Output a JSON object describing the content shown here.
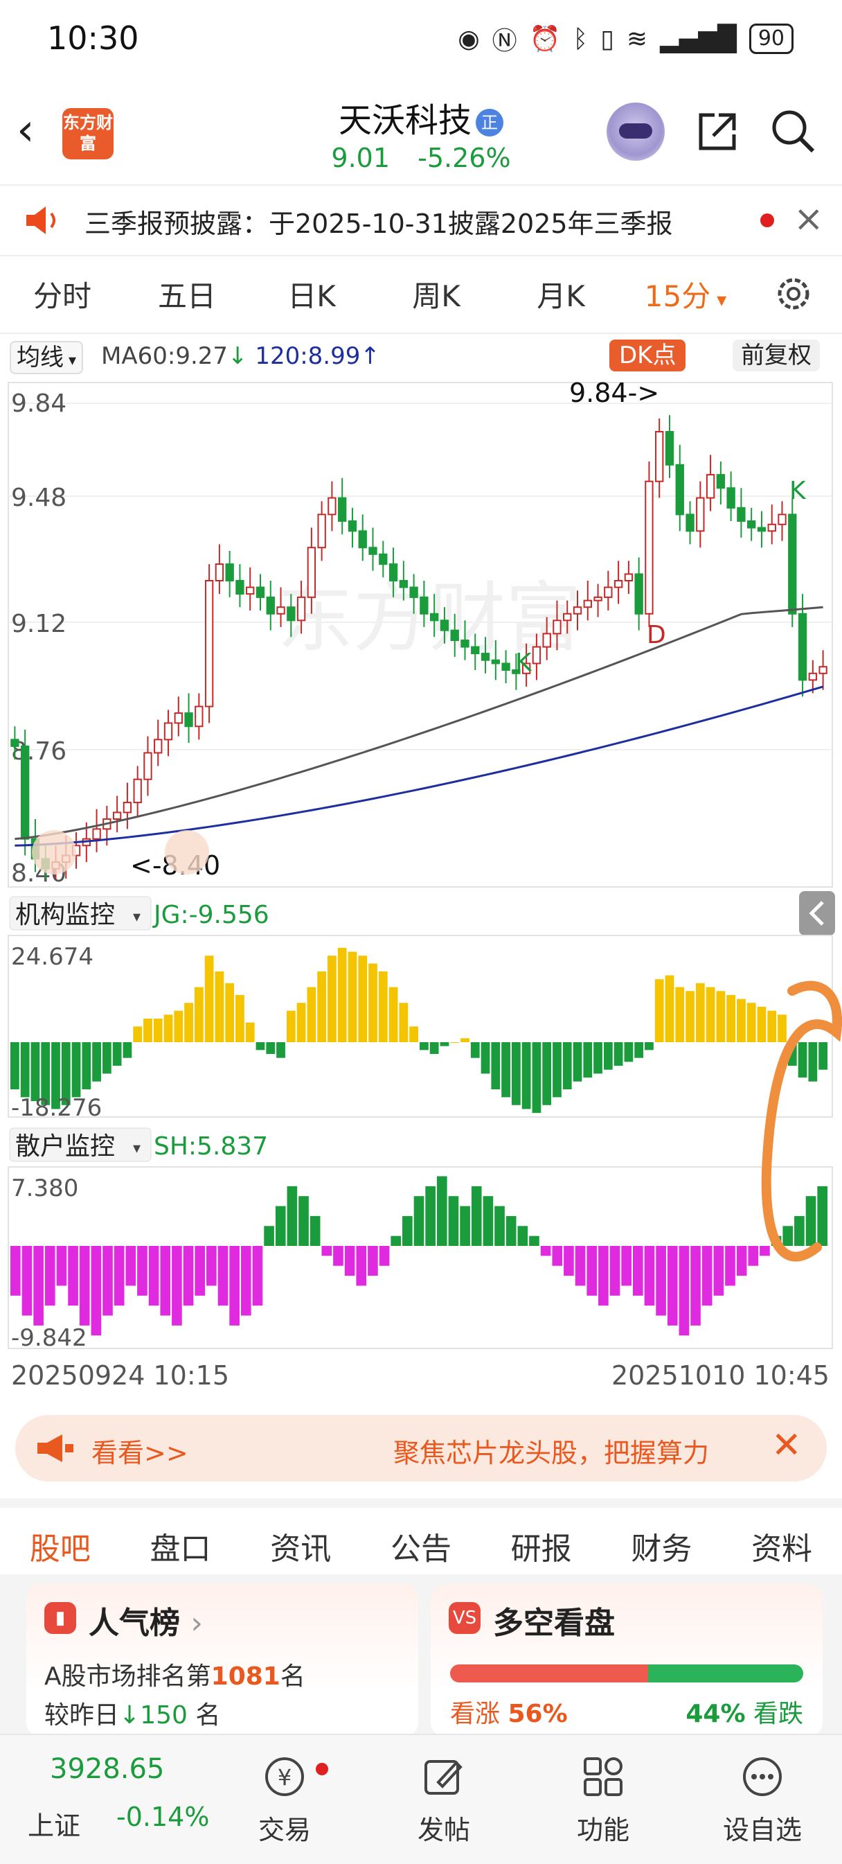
{
  "status_bar": {
    "time": "10:30",
    "battery": "90"
  },
  "header": {
    "logo_text": "东方财富",
    "stock_name": "天沃科技",
    "badge": "正",
    "price": "9.01",
    "change_pct": "-5.26%"
  },
  "notice": {
    "text": "三季报预披露：于2025-10-31披露2025年三季报"
  },
  "tabs": [
    "分时",
    "五日",
    "日K",
    "周K",
    "月K",
    "15分"
  ],
  "active_tab": "15分",
  "chart_header": {
    "type_selector": "均线",
    "ma60": "MA60:9.27",
    "ma60_arrow": "↓",
    "ma120": "120:8.99",
    "ma120_arrow": "↑",
    "dk_button": "DK点",
    "adjust_button": "前复权"
  },
  "price_axis": [
    "9.84",
    "9.48",
    "9.12",
    "8.76",
    "8.40"
  ],
  "annotations": {
    "high": "9.84->",
    "low": "<-8.40",
    "k": "K",
    "d": "D"
  },
  "indicator1": {
    "selector": "机构监控",
    "value": "JG:-9.556",
    "max": "24.674",
    "min": "-18.276"
  },
  "indicator2": {
    "selector": "散户监控",
    "value": "SH:5.837",
    "max": "7.380",
    "min": "-9.842"
  },
  "time_axis": {
    "start": "20250924 10:15",
    "end": "20251010 10:45"
  },
  "ad_bar": {
    "left": "看看>>",
    "right": "聚焦芯片龙头股，把握算力",
    "close": "✕"
  },
  "sub_tabs": [
    "股吧",
    "盘口",
    "资讯",
    "公告",
    "研报",
    "财务",
    "资料"
  ],
  "active_sub_tab": "股吧",
  "card_popularity": {
    "title": "人气榜",
    "icon": "pop-chart-icon",
    "line1_prefix": "A股市场排名第",
    "rank": "1081",
    "line1_suffix": "名",
    "line2_prefix": "较昨日",
    "change": "150",
    "line2_suffix": "名"
  },
  "card_vs": {
    "title": "多空看盘",
    "icon_text": "VS",
    "rise_label": "看涨",
    "rise_pct": "56%",
    "fall_label": "看跌",
    "fall_pct": "44%",
    "rise_fraction": 0.56
  },
  "bottom_nav": {
    "index_value": "3928.65",
    "index_name": "上证",
    "index_change": "-0.14%",
    "items": [
      "交易",
      "发帖",
      "功能",
      "设自选"
    ]
  },
  "colors": {
    "up": "#c62828",
    "down": "#1a9c3d",
    "accent": "#ec6c1c",
    "ma60": "#555555",
    "ma120": "#1c2f9c",
    "jg_pos": "#f5c400",
    "sh_neg": "#e02ae0"
  },
  "chart_data": {
    "type": "candlestick",
    "yticks": [
      9.84,
      9.48,
      9.12,
      8.76,
      8.4
    ],
    "ylim": [
      8.4,
      9.84
    ],
    "xlabels": [
      "20250924 10:15",
      "20251010 10:45"
    ],
    "series": [
      {
        "name": "MA60",
        "last": 9.27
      },
      {
        "name": "120",
        "last": 8.99
      }
    ],
    "candles_close": [
      8.8,
      8.52,
      8.46,
      8.43,
      8.45,
      8.47,
      8.5,
      8.52,
      8.55,
      8.58,
      8.6,
      8.63,
      8.7,
      8.78,
      8.82,
      8.87,
      8.9,
      8.86,
      8.92,
      9.3,
      9.35,
      9.3,
      9.26,
      9.28,
      9.25,
      9.2,
      9.22,
      9.18,
      9.25,
      9.4,
      9.5,
      9.55,
      9.48,
      9.45,
      9.4,
      9.38,
      9.35,
      9.3,
      9.28,
      9.25,
      9.2,
      9.18,
      9.15,
      9.12,
      9.1,
      9.08,
      9.06,
      9.05,
      9.03,
      9.02,
      9.05,
      9.1,
      9.14,
      9.18,
      9.2,
      9.22,
      9.24,
      9.25,
      9.28,
      9.3,
      9.32,
      9.2,
      9.6,
      9.75,
      9.65,
      9.5,
      9.45,
      9.55,
      9.62,
      9.58,
      9.52,
      9.48,
      9.46,
      9.45,
      9.47,
      9.5,
      9.2,
      9.0,
      9.02,
      9.04
    ],
    "jg_values": [
      -12,
      -14,
      -15,
      -16,
      -17,
      -16,
      -14,
      -12,
      -10,
      -8,
      -6,
      -4,
      4,
      6,
      6,
      7,
      8,
      10,
      14,
      22,
      18,
      15,
      12,
      5,
      -2,
      -3,
      -4,
      8,
      10,
      14,
      18,
      22,
      24,
      23,
      22,
      20,
      18,
      14,
      10,
      4,
      -2,
      -3,
      -1,
      0,
      1,
      -4,
      -8,
      -12,
      -14,
      -16,
      -17,
      -18,
      -16,
      -14,
      -12,
      -10,
      -9,
      -8,
      -7,
      -6,
      -5,
      -4,
      -2,
      16,
      17,
      14,
      13,
      15,
      14,
      13,
      12,
      11,
      10,
      9,
      8,
      7,
      -6,
      -9,
      -10,
      -7
    ],
    "sh_values": [
      -5,
      -7,
      -8,
      -6,
      -4,
      -6,
      -8,
      -9,
      -7,
      -6,
      -4,
      -5,
      -6,
      -7,
      -8,
      -6,
      -5,
      -4,
      -6,
      -8,
      -7,
      -6,
      2,
      4,
      6,
      5,
      3,
      -1,
      -2,
      -3,
      -4,
      -3,
      -2,
      1,
      3,
      5,
      6,
      7,
      5,
      4,
      6,
      5,
      4,
      3,
      2,
      1,
      -1,
      -2,
      -3,
      -4,
      -5,
      -6,
      -5,
      -4,
      -5,
      -6,
      -7,
      -8,
      -9,
      -8,
      -6,
      -5,
      -4,
      -3,
      -2,
      -1,
      1,
      2,
      3,
      5,
      6
    ],
    "price_annotations": {
      "high": 9.84,
      "low": 8.4
    }
  }
}
